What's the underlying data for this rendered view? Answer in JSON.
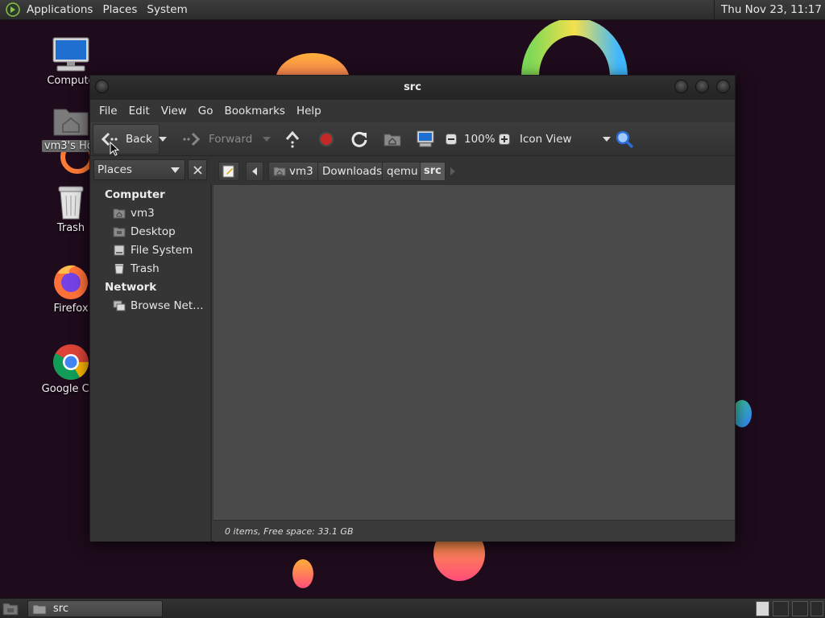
{
  "top_panel": {
    "menus": [
      "Applications",
      "Places",
      "System"
    ],
    "clock": "Thu Nov 23, 11:17"
  },
  "desktop_icons": [
    {
      "label": "Compute",
      "icon": "computer-icon"
    },
    {
      "label": "vm3's Hor",
      "icon": "home-folder-icon"
    },
    {
      "label": "Trash",
      "icon": "trash-icon"
    },
    {
      "label": "Firefox",
      "icon": "firefox-icon"
    },
    {
      "label": "Google Chr",
      "icon": "chrome-icon"
    }
  ],
  "window": {
    "title": "src",
    "menus": [
      "File",
      "Edit",
      "View",
      "Go",
      "Bookmarks",
      "Help"
    ],
    "toolbar": {
      "back": "Back",
      "forward": "Forward",
      "zoom": "100%",
      "view_mode": "Icon View"
    },
    "side_pane": {
      "selector": "Places",
      "sections": [
        {
          "heading": "Computer",
          "items": [
            "vm3",
            "Desktop",
            "File System",
            "Trash"
          ]
        },
        {
          "heading": "Network",
          "items": [
            "Browse Net…"
          ]
        }
      ]
    },
    "breadcrumbs": [
      "vm3",
      "Downloads",
      "qemu",
      "src"
    ],
    "status": "0 items, Free space: 33.1 GB"
  },
  "taskbar": {
    "tasks": [
      {
        "label": "src",
        "icon": "folder-icon"
      }
    ]
  },
  "colors": {
    "wallpaper": "#1e0b1c",
    "stop": "#c62828",
    "accent_orange": "#ff8a3d",
    "accent_pink": "#ff4d79"
  }
}
